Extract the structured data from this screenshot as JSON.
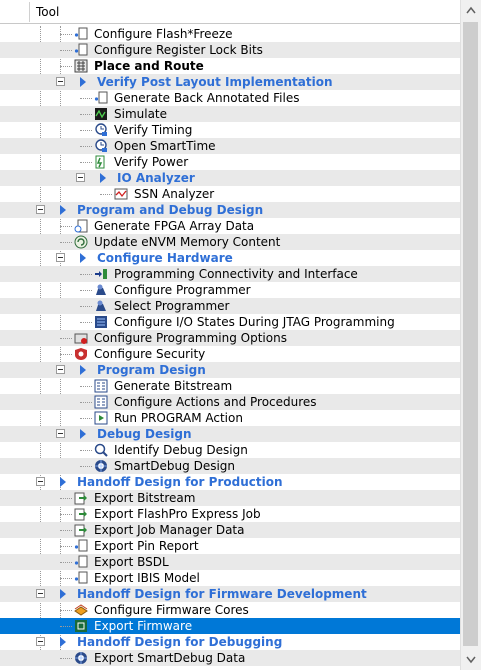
{
  "header": {
    "column_title": "Tool"
  },
  "tree": [
    {
      "label": "Configure Flash*Freeze",
      "level": 2,
      "icon": "document-tool-icon"
    },
    {
      "label": "Configure Register Lock Bits",
      "level": 2,
      "icon": "document-tool-icon"
    },
    {
      "label": "Place and Route",
      "level": 2,
      "icon": "place-route-icon",
      "bold": true
    },
    {
      "label": "Verify Post Layout Implementation",
      "level": 2,
      "folder": true,
      "expanded": true
    },
    {
      "label": "Generate Back Annotated Files",
      "level": 3,
      "icon": "document-tool-icon"
    },
    {
      "label": "Simulate",
      "level": 3,
      "icon": "simulate-icon"
    },
    {
      "label": "Verify Timing",
      "level": 3,
      "icon": "timing-icon"
    },
    {
      "label": "Open SmartTime",
      "level": 3,
      "icon": "timing-icon"
    },
    {
      "label": "Verify Power",
      "level": 3,
      "icon": "power-icon"
    },
    {
      "label": "IO Analyzer",
      "level": 3,
      "folder": true,
      "expanded": true
    },
    {
      "label": "SSN Analyzer",
      "level": 4,
      "icon": "ssn-analyzer-icon"
    },
    {
      "label": "Program and Debug Design",
      "level": 1,
      "folder": true,
      "expanded": true
    },
    {
      "label": "Generate FPGA Array Data",
      "level": 2,
      "icon": "generate-data-icon"
    },
    {
      "label": "Update eNVM Memory Content",
      "level": 2,
      "icon": "memory-icon"
    },
    {
      "label": "Configure Hardware",
      "level": 2,
      "folder": true,
      "expanded": true
    },
    {
      "label": "Programming Connectivity and Interface",
      "level": 3,
      "icon": "connectivity-icon"
    },
    {
      "label": "Configure Programmer",
      "level": 3,
      "icon": "programmer-icon"
    },
    {
      "label": "Select Programmer",
      "level": 3,
      "icon": "programmer-icon"
    },
    {
      "label": "Configure I/O States During JTAG Programming",
      "level": 3,
      "icon": "io-states-icon"
    },
    {
      "label": "Configure Programming Options",
      "level": 2,
      "icon": "options-icon"
    },
    {
      "label": "Configure Security",
      "level": 2,
      "icon": "security-icon"
    },
    {
      "label": "Program Design",
      "level": 2,
      "folder": true,
      "expanded": true
    },
    {
      "label": "Generate Bitstream",
      "level": 3,
      "icon": "bitstream-icon"
    },
    {
      "label": "Configure Actions and Procedures",
      "level": 3,
      "icon": "bitstream-icon"
    },
    {
      "label": "Run PROGRAM Action",
      "level": 3,
      "icon": "run-action-icon"
    },
    {
      "label": "Debug Design",
      "level": 2,
      "folder": true,
      "expanded": true
    },
    {
      "label": "Identify Debug Design",
      "level": 3,
      "icon": "identify-icon"
    },
    {
      "label": "SmartDebug Design",
      "level": 3,
      "icon": "smartdebug-icon"
    },
    {
      "label": "Handoff Design for Production",
      "level": 1,
      "folder": true,
      "expanded": true
    },
    {
      "label": "Export Bitstream",
      "level": 2,
      "icon": "export-icon"
    },
    {
      "label": "Export FlashPro Express Job",
      "level": 2,
      "icon": "export-icon"
    },
    {
      "label": "Export Job Manager Data",
      "level": 2,
      "icon": "export-icon"
    },
    {
      "label": "Export Pin Report",
      "level": 2,
      "icon": "document-tool-icon"
    },
    {
      "label": "Export BSDL",
      "level": 2,
      "icon": "document-tool-icon"
    },
    {
      "label": "Export IBIS Model",
      "level": 2,
      "icon": "document-tool-icon"
    },
    {
      "label": "Handoff Design for Firmware Development",
      "level": 1,
      "folder": true,
      "expanded": true
    },
    {
      "label": "Configure Firmware Cores",
      "level": 2,
      "icon": "firmware-cores-icon"
    },
    {
      "label": "Export Firmware",
      "level": 2,
      "icon": "export-firmware-icon",
      "selected": true
    },
    {
      "label": "Handoff Design for Debugging",
      "level": 1,
      "folder": true,
      "expanded": true
    },
    {
      "label": "Export SmartDebug Data",
      "level": 2,
      "icon": "smartdebug-icon"
    }
  ],
  "scrollbar": {
    "up_icon": "scroll-up-arrow-icon",
    "down_icon": "scroll-down-arrow-icon"
  },
  "colors": {
    "folder_text": "#2f6fd6",
    "selection": "#0078d7",
    "alt_row": "#e9e9e9"
  }
}
